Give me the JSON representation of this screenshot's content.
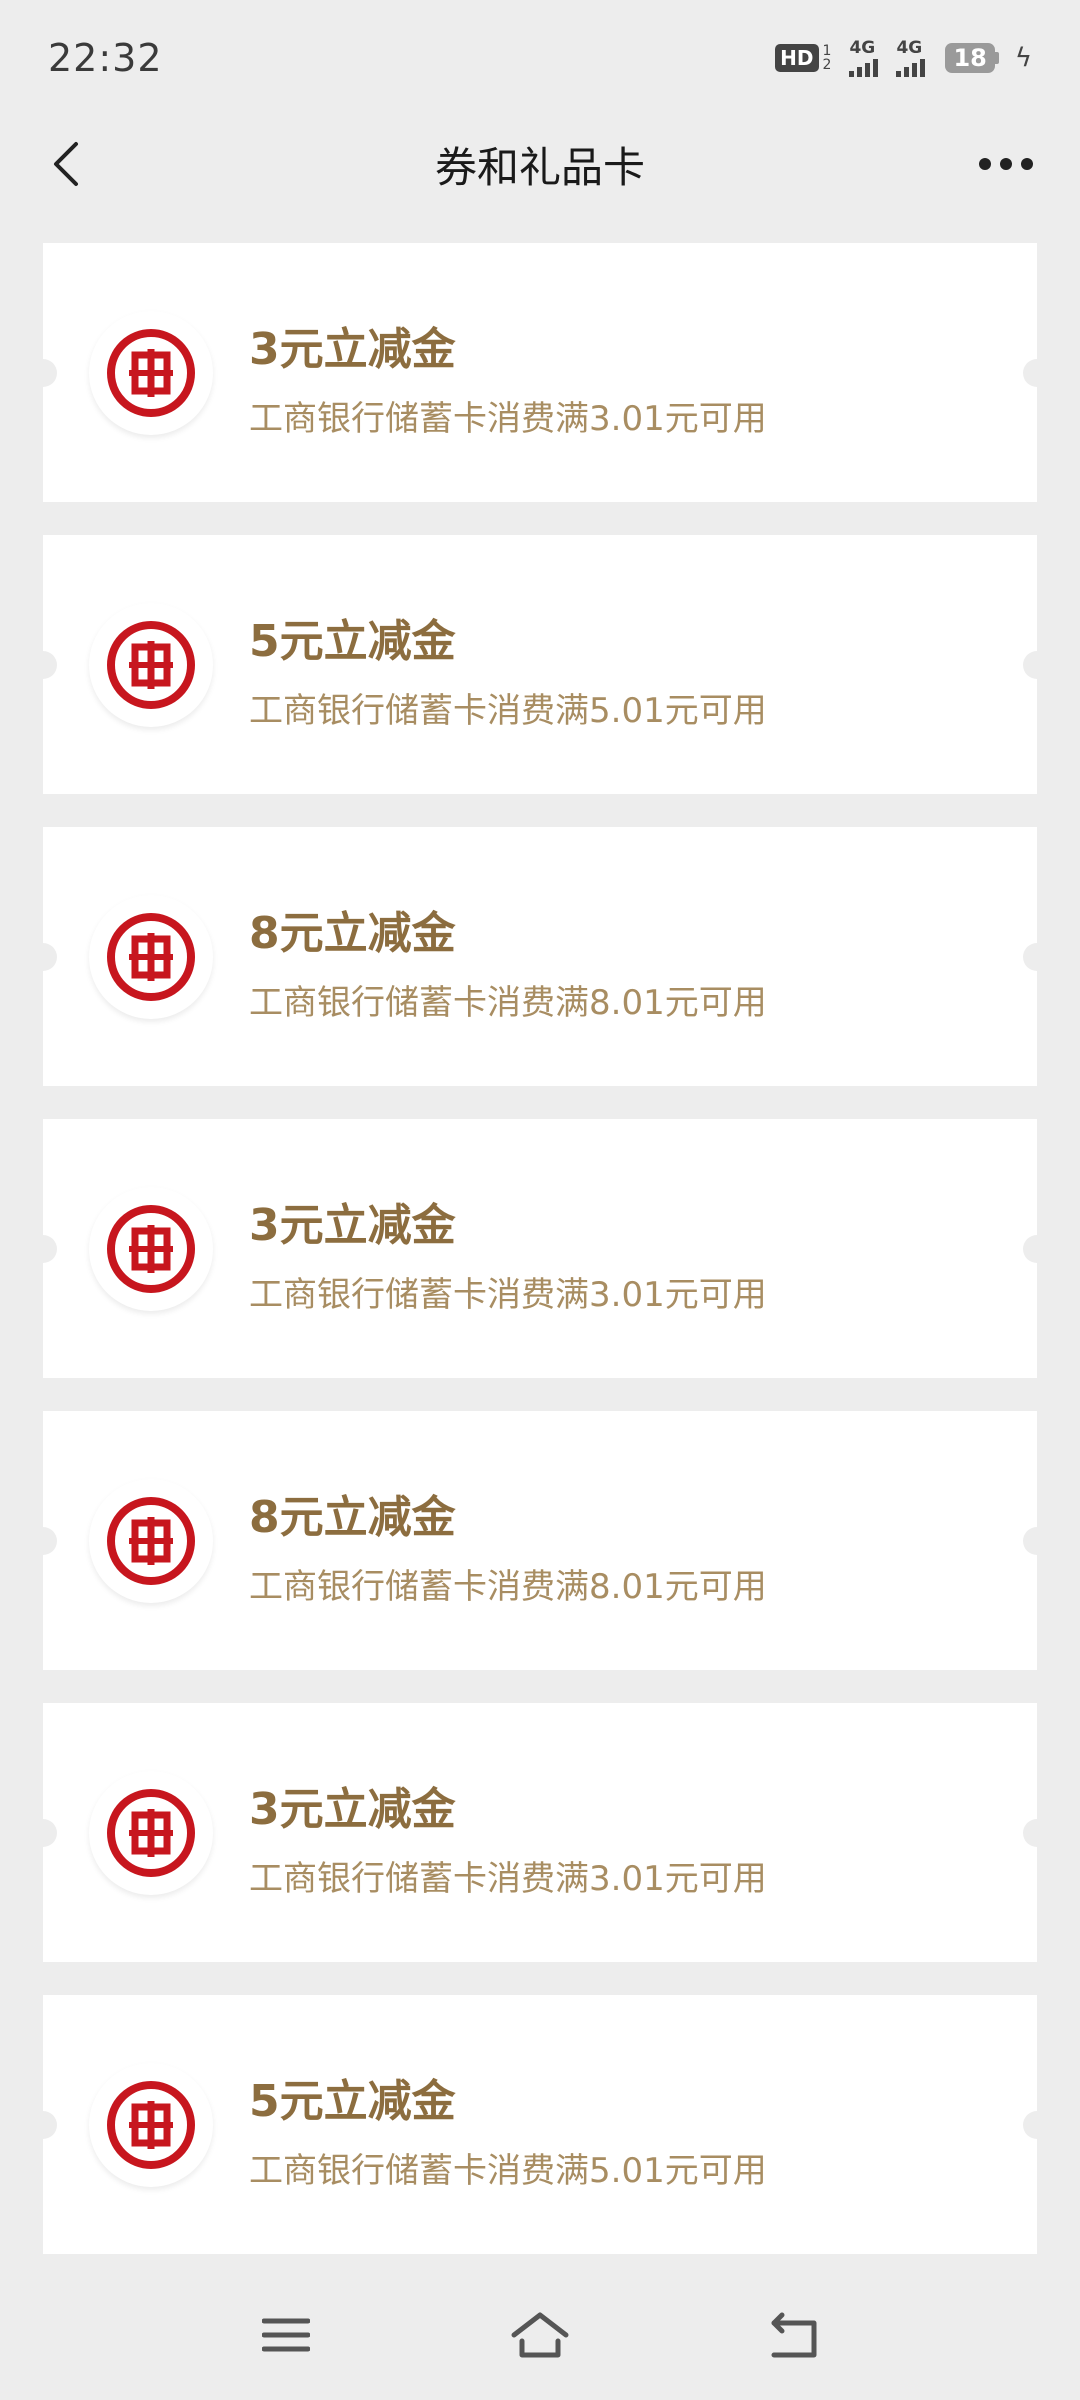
{
  "status_bar": {
    "time": "22:32",
    "hd": "HD",
    "sim_top": "1",
    "sim_bottom": "2",
    "net1": "4G",
    "net2": "4G",
    "battery": "18"
  },
  "header": {
    "title": "券和礼品卡"
  },
  "coupons": [
    {
      "title": "3元立减金",
      "desc": "工商银行储蓄卡消费满3.01元可用"
    },
    {
      "title": "5元立减金",
      "desc": "工商银行储蓄卡消费满5.01元可用"
    },
    {
      "title": "8元立减金",
      "desc": "工商银行储蓄卡消费满8.01元可用"
    },
    {
      "title": "3元立减金",
      "desc": "工商银行储蓄卡消费满3.01元可用"
    },
    {
      "title": "8元立减金",
      "desc": "工商银行储蓄卡消费满8.01元可用"
    },
    {
      "title": "3元立减金",
      "desc": "工商银行储蓄卡消费满3.01元可用"
    },
    {
      "title": "5元立减金",
      "desc": "工商银行储蓄卡消费满5.01元可用"
    }
  ],
  "colors": {
    "background": "#ededed",
    "coupon_title": "#8c6d3f",
    "coupon_desc": "#a88d62",
    "icbc_red": "#c7161e"
  },
  "icons": {
    "back": "back-arrow-icon",
    "more": "more-dots-icon",
    "logo": "icbc-logo-icon",
    "nav_menu": "menu-icon",
    "nav_home": "home-icon",
    "nav_back": "return-icon"
  }
}
